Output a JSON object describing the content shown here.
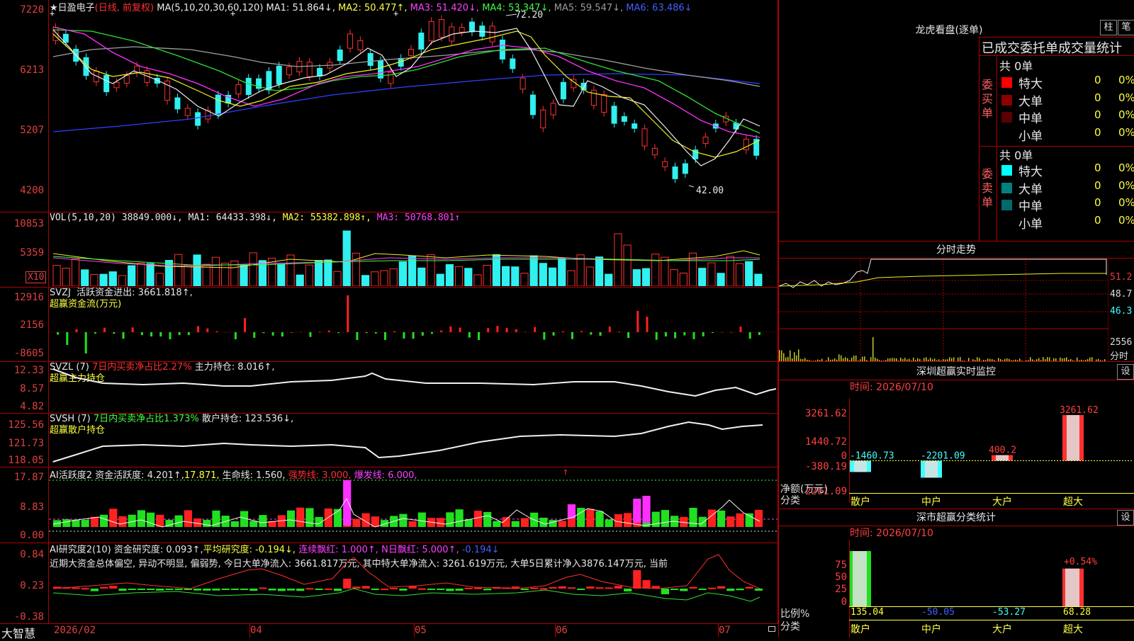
{
  "main": {
    "header": {
      "star": "★",
      "stock_name": "日盈电子",
      "period": "(日线, 前复权)",
      "ma_set": "MA(5,10,20,30,60,120)",
      "ma1": "MA1: 51.864↓,",
      "ma2": "MA2: 50.477↑,",
      "ma3": "MA3: 51.420↓,",
      "ma4": "MA4: 53.347↓,",
      "ma5": "MA5: 59.547↓,",
      "ma6": "MA6: 63.486↓"
    },
    "y_ticks": [
      "7220",
      "6213",
      "5207",
      "4200"
    ],
    "high_label": "72.20",
    "low_label": "42.00",
    "marker": "+"
  },
  "vol": {
    "header": {
      "name": "VOL(5,10,20)",
      "v": "38849.000↓,",
      "ma1": "MA1: 64433.398↓,",
      "ma2": "MA2: 55382.898↑,",
      "ma3": "MA3: 50768.801↑"
    },
    "y_ticks": [
      "10853",
      "5359"
    ],
    "unit": "X10"
  },
  "svzj": {
    "header": {
      "name": "SVZJ",
      "line": "活跃资金进出: 3661.818↑,",
      "sub": "超赢资金流(万元)"
    },
    "y_ticks": [
      "12916",
      "2156",
      "-8605"
    ]
  },
  "svzl": {
    "header": {
      "name": "SVZL (7)",
      "ratio": "7日内买卖净占比2.27%",
      "hold": "主力持仓: 8.016↑,",
      "sub": "超赢主力持仓"
    },
    "y_ticks": [
      "12.33",
      "8.57",
      "4.82"
    ]
  },
  "svsh": {
    "header": {
      "name": "SVSH (7)",
      "ratio": "7日内买卖净占比1.373%",
      "hold": "散户持仓: 123.536↓,",
      "sub": "超赢散户持仓"
    },
    "y_ticks": [
      "125.56",
      "121.73",
      "118.05"
    ]
  },
  "ai1": {
    "header": {
      "name": "AI活跃度2",
      "a": "资金活跃度: 4.201↑,",
      "b": "17.871,",
      "c": "生命线: 1.560,",
      "d": "强势线: 3.000,",
      "e": "爆发线: 6.000,",
      "arrow": "↑"
    },
    "y_ticks": [
      "17.87",
      "8.83",
      "0.00"
    ]
  },
  "ai2": {
    "header": {
      "name": "AI研究度2(10)",
      "a": "资金研究度: 0.093↑,",
      "b": "平均研究度: -0.194↓,",
      "c": "连续飘红: 1.000↑,",
      "d": "N日飘红: 5.000↑,",
      "e": "-0.194↓"
    },
    "summary": "近期大资金总体偏空, 异动不明显, 偏弱势, 今日大单净流入: 3661.817万元, 其中特大单净流入: 3261.619万元, 大单5日累计净入3876.147万元, 当前",
    "y_ticks": [
      "0.84",
      "0.23",
      "-0.38"
    ]
  },
  "xaxis": {
    "brand": "大智慧",
    "labels": [
      "2026/02",
      "04",
      "05",
      "06",
      "07"
    ]
  },
  "lhb": {
    "title": "龙虎看盘(逐单)",
    "btn1": "柱",
    "btn2": "笔",
    "heading": "已成交委托单成交量统计",
    "buy": {
      "vertical": [
        "委",
        "买",
        "单"
      ],
      "total": "共 0单",
      "rows": [
        {
          "label": "特大",
          "v": "0",
          "p": "0%",
          "color": "#ff0000"
        },
        {
          "label": "大单",
          "v": "0",
          "p": "0%",
          "color": "#8b0000"
        },
        {
          "label": "中单",
          "v": "0",
          "p": "0%",
          "color": "#5a0000"
        },
        {
          "label": "小单",
          "v": "0",
          "p": "0%",
          "color": ""
        }
      ]
    },
    "sell": {
      "vertical": [
        "委",
        "卖",
        "单"
      ],
      "total": "共 0单",
      "rows": [
        {
          "label": "特大",
          "v": "0",
          "p": "0%",
          "color": "#00ffff"
        },
        {
          "label": "大单",
          "v": "0",
          "p": "0%",
          "color": "#008080"
        },
        {
          "label": "中单",
          "v": "0",
          "p": "0%",
          "color": "#006a6a"
        },
        {
          "label": "小单",
          "v": "0",
          "p": "0%",
          "color": ""
        }
      ]
    }
  },
  "intraday": {
    "title": "分时走势",
    "y_labels": [
      "51.2",
      "48.7",
      "46.3"
    ],
    "vol_label": "2556",
    "vol_unit": "分时"
  },
  "monitor": {
    "title": "深圳超赢实时监控",
    "settings": "设",
    "time": "时间: 2026/07/10",
    "y_ticks": [
      "3261.62",
      "1440.72",
      "0",
      "-380.19",
      "-2201.09"
    ],
    "axis_label_1": "净额(万元)",
    "axis_label_2": "分类",
    "categories": [
      "散户",
      "中户",
      "大户",
      "超大"
    ],
    "values": [
      -1460.73,
      -2201.09,
      400.2,
      3261.62
    ],
    "value_labels": [
      "-1460.73",
      "-2201.09",
      "400.2",
      "3261.62"
    ]
  },
  "classify": {
    "title": "深市超赢分类统计",
    "settings": "设",
    "time": "时间: 2026/07/10",
    "y_ticks": [
      "75",
      "50",
      "25",
      "0"
    ],
    "axis_label_1": "比例%",
    "axis_label_2": "分类",
    "categories": [
      "散户",
      "中户",
      "大户",
      "超大"
    ],
    "values": [
      135.04,
      -50.05,
      -53.27,
      68.28
    ],
    "value_labels": [
      "135.04",
      "-50.05",
      "-53.27",
      "68.28"
    ],
    "top_label": "+0.54%"
  }
}
